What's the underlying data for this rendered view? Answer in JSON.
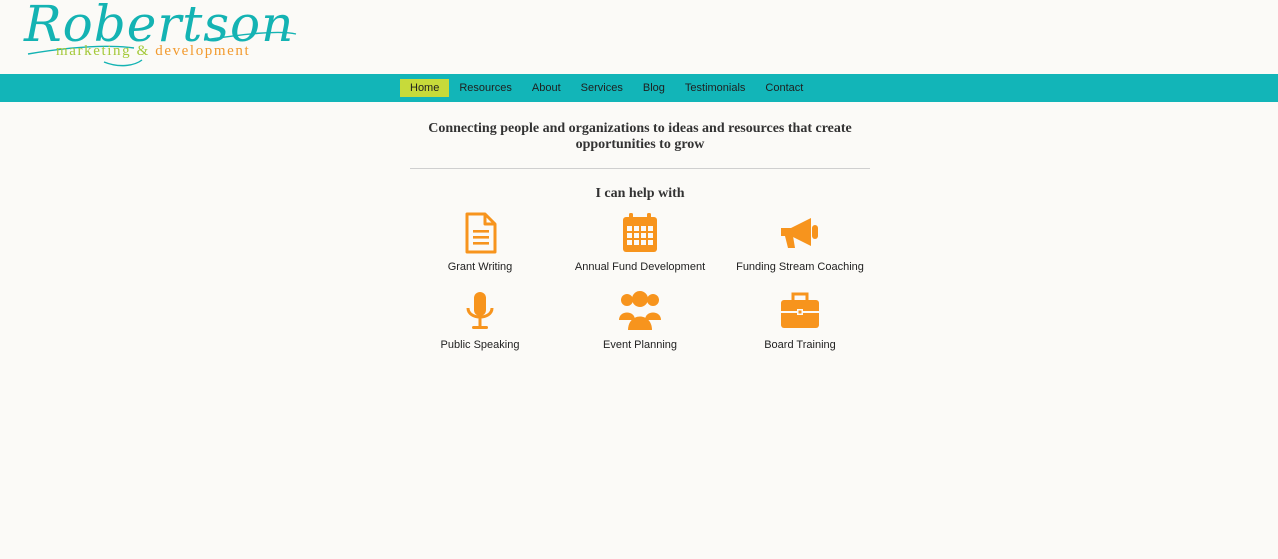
{
  "logo": {
    "script": "Robertson",
    "tagline_left": "marketing",
    "tagline_amp": "&",
    "tagline_right": "development"
  },
  "nav": {
    "items": [
      {
        "label": "Home",
        "active": true
      },
      {
        "label": "Resources"
      },
      {
        "label": "About"
      },
      {
        "label": "Services"
      },
      {
        "label": "Blog"
      },
      {
        "label": "Testimonials"
      },
      {
        "label": "Contact"
      }
    ]
  },
  "main": {
    "tagline": "Connecting people and organizations to ideas and resources that create opportunities to grow",
    "help_heading": "I can help with",
    "services": [
      {
        "label": "Grant Writing",
        "icon": "document-icon"
      },
      {
        "label": "Annual Fund Development",
        "icon": "calendar-icon"
      },
      {
        "label": "Funding Stream Coaching",
        "icon": "megaphone-icon"
      },
      {
        "label": "Public Speaking",
        "icon": "microphone-icon"
      },
      {
        "label": "Event Planning",
        "icon": "group-icon"
      },
      {
        "label": "Board Training",
        "icon": "briefcase-icon"
      }
    ]
  },
  "colors": {
    "teal": "#12b5b8",
    "nav_active": "#c7da3a",
    "icon_orange": "#f7941d",
    "tag_green": "#a4c93a",
    "tag_orange": "#f29a2e"
  }
}
